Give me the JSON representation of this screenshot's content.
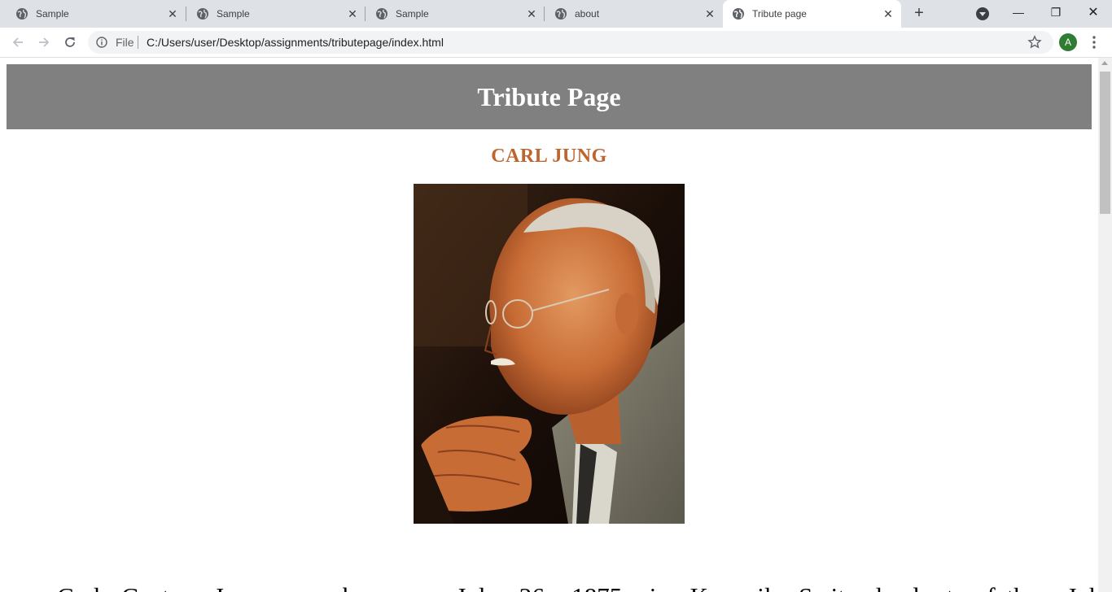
{
  "browser": {
    "tabs": [
      {
        "title": "Sample",
        "active": false
      },
      {
        "title": "Sample",
        "active": false
      },
      {
        "title": "Sample",
        "active": false
      },
      {
        "title": "about",
        "active": false
      },
      {
        "title": "Tribute page",
        "active": true
      }
    ],
    "new_tab_symbol": "+",
    "tab_close_symbol": "✕",
    "window_controls": {
      "minimize": "—",
      "restore": "❐",
      "close": "✕"
    },
    "address_bar": {
      "scheme_label": "File",
      "url": "C:/Users/user/Desktop/assignments/tributepage/index.html"
    },
    "profile_initial": "A",
    "colors": {
      "tabstrip": "#dee1e6",
      "profile": "#2e7d32"
    }
  },
  "page": {
    "header_title": "Tribute Page",
    "person_name": "CARL JUNG",
    "bio_visible_text": "Carl Gustav Jung was born on July 26, 1875, in Kesswil, Switzerland, to father Johann Paul",
    "colors": {
      "header_bg": "#808080",
      "name": "#c0642d"
    }
  },
  "icons": [
    "globe-icon",
    "close-icon",
    "plus-icon",
    "tab-search-icon",
    "back-arrow-icon",
    "forward-arrow-icon",
    "reload-icon",
    "info-icon",
    "star-icon",
    "more-vert-icon"
  ]
}
